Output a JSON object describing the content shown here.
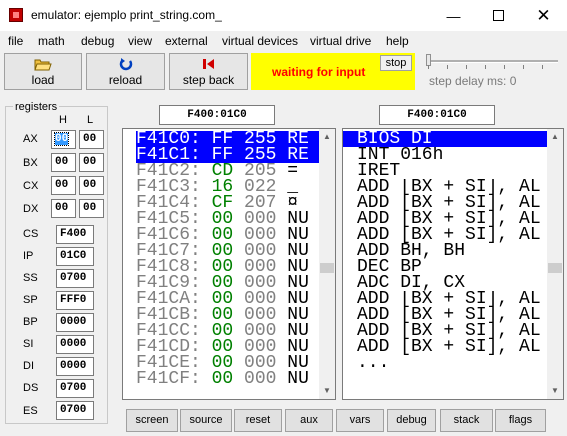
{
  "window": {
    "title": "emulator: ejemplo print_string.com_"
  },
  "menu": [
    "file",
    "math",
    "debug",
    "view",
    "external",
    "virtual devices",
    "virtual drive",
    "help"
  ],
  "toolbar": {
    "load": "load",
    "reload": "reload",
    "step_back": "step back",
    "status": "waiting for input",
    "stop": "stop",
    "step_delay": "step delay ms: 0"
  },
  "registers": {
    "title": "registers",
    "h_label": "H",
    "l_label": "L",
    "pairs": [
      {
        "name": "AX",
        "h": "00",
        "l": "00"
      },
      {
        "name": "BX",
        "h": "00",
        "l": "00"
      },
      {
        "name": "CX",
        "h": "00",
        "l": "00"
      },
      {
        "name": "DX",
        "h": "00",
        "l": "00"
      }
    ],
    "single": [
      {
        "name": "CS",
        "value": "F400"
      },
      {
        "name": "IP",
        "value": "01C0"
      },
      {
        "name": "SS",
        "value": "0700"
      },
      {
        "name": "SP",
        "value": "FFF0"
      },
      {
        "name": "BP",
        "value": "0000"
      },
      {
        "name": "SI",
        "value": "0000"
      },
      {
        "name": "DI",
        "value": "0000"
      },
      {
        "name": "DS",
        "value": "0700"
      },
      {
        "name": "ES",
        "value": "0700"
      }
    ]
  },
  "memory_address": "F400:01C0",
  "disasm_address": "F400:01C0",
  "memory_rows": [
    {
      "addr": "F41C0:",
      "hex": "FF",
      "dec": "255",
      "ch": "RE"
    },
    {
      "addr": "F41C1:",
      "hex": "FF",
      "dec": "255",
      "ch": "RE"
    },
    {
      "addr": "F41C2:",
      "hex": "CD",
      "dec": "205",
      "ch": "="
    },
    {
      "addr": "F41C3:",
      "hex": "16",
      "dec": "022",
      "ch": "_"
    },
    {
      "addr": "F41C4:",
      "hex": "CF",
      "dec": "207",
      "ch": "¤"
    },
    {
      "addr": "F41C5:",
      "hex": "00",
      "dec": "000",
      "ch": "NU"
    },
    {
      "addr": "F41C6:",
      "hex": "00",
      "dec": "000",
      "ch": "NU"
    },
    {
      "addr": "F41C7:",
      "hex": "00",
      "dec": "000",
      "ch": "NU"
    },
    {
      "addr": "F41C8:",
      "hex": "00",
      "dec": "000",
      "ch": "NU"
    },
    {
      "addr": "F41C9:",
      "hex": "00",
      "dec": "000",
      "ch": "NU"
    },
    {
      "addr": "F41CA:",
      "hex": "00",
      "dec": "000",
      "ch": "NU"
    },
    {
      "addr": "F41CB:",
      "hex": "00",
      "dec": "000",
      "ch": "NU"
    },
    {
      "addr": "F41CC:",
      "hex": "00",
      "dec": "000",
      "ch": "NU"
    },
    {
      "addr": "F41CD:",
      "hex": "00",
      "dec": "000",
      "ch": "NU"
    },
    {
      "addr": "F41CE:",
      "hex": "00",
      "dec": "000",
      "ch": "NU"
    },
    {
      "addr": "F41CF:",
      "hex": "00",
      "dec": "000",
      "ch": "NU"
    }
  ],
  "disasm_rows": [
    "BIOS DI",
    "INT 016h",
    "IRET",
    "ADD [BX + SI], AL",
    "ADD [BX + SI], AL",
    "ADD [BX + SI], AL",
    "ADD [BX + SI], AL",
    "ADD BH, BH",
    "DEC BP",
    "ADC DI, CX",
    "ADD [BX + SI], AL",
    "ADD [BX + SI], AL",
    "ADD [BX + SI], AL",
    "ADD [BX + SI], AL",
    "..."
  ],
  "bottom_buttons": [
    "screen",
    "source",
    "reset",
    "aux",
    "vars",
    "debug",
    "stack",
    "flags"
  ],
  "colors": {
    "selection": "#0000ff",
    "status_bg": "#ffff00",
    "status_text": "#ff0000",
    "hex_green": "#008000"
  }
}
